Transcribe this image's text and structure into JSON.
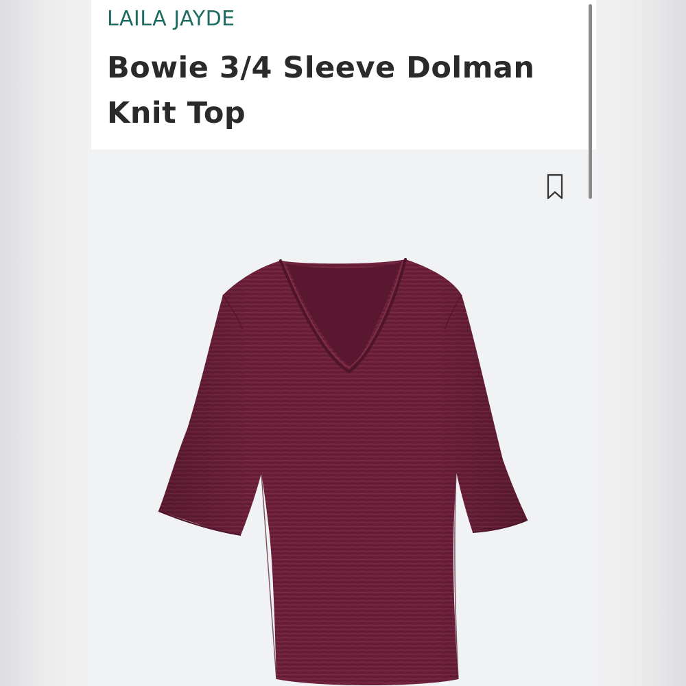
{
  "product": {
    "brand": "LAILA JAYDE",
    "title": "Bowie 3/4 Sleeve Dolman Knit Top"
  },
  "icons": {
    "bookmark": "bookmark-icon"
  },
  "colors": {
    "brand_text": "#1e6b62",
    "title_text": "#2a2a2a",
    "garment": "#6b1f3a",
    "image_background": "#f1f2f4"
  }
}
